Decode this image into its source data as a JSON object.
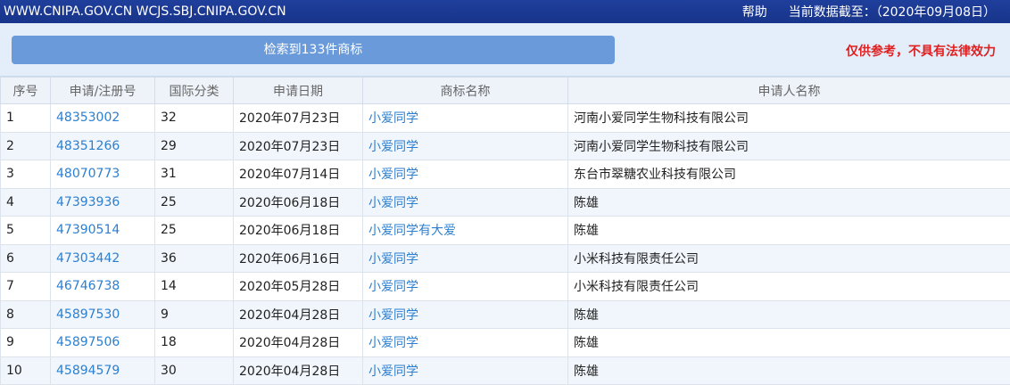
{
  "topbar": {
    "site": "WWW.CNIPA.GOV.CN WCJS.SBJ.CNIPA.GOV.CN",
    "help": "帮助",
    "data_as_of": "当前数据截至：（2020年09月08日）"
  },
  "search": {
    "result_label": "检索到133件商标",
    "disclaimer": "仅供参考，不具有法律效力"
  },
  "table": {
    "headers": [
      "序号",
      "申请/注册号",
      "国际分类",
      "申请日期",
      "商标名称",
      "申请人名称"
    ],
    "rows": [
      {
        "no": "1",
        "reg": "48353002",
        "cls": "32",
        "date": "2020年07月23日",
        "name": "小爱同学",
        "applicant": "河南小爱同学生物科技有限公司"
      },
      {
        "no": "2",
        "reg": "48351266",
        "cls": "29",
        "date": "2020年07月23日",
        "name": "小爱同学",
        "applicant": "河南小爱同学生物科技有限公司"
      },
      {
        "no": "3",
        "reg": "48070773",
        "cls": "31",
        "date": "2020年07月14日",
        "name": "小爱同学",
        "applicant": "东台市翠糖农业科技有限公司"
      },
      {
        "no": "4",
        "reg": "47393936",
        "cls": "25",
        "date": "2020年06月18日",
        "name": "小爱同学",
        "applicant": "陈雄"
      },
      {
        "no": "5",
        "reg": "47390514",
        "cls": "25",
        "date": "2020年06月18日",
        "name": "小爱同学有大爱",
        "applicant": "陈雄"
      },
      {
        "no": "6",
        "reg": "47303442",
        "cls": "36",
        "date": "2020年06月16日",
        "name": "小爱同学",
        "applicant": "小米科技有限责任公司"
      },
      {
        "no": "7",
        "reg": "46746738",
        "cls": "14",
        "date": "2020年05月28日",
        "name": "小爱同学",
        "applicant": "小米科技有限责任公司"
      },
      {
        "no": "8",
        "reg": "45897530",
        "cls": "9",
        "date": "2020年04月28日",
        "name": "小爱同学",
        "applicant": "陈雄"
      },
      {
        "no": "9",
        "reg": "45897506",
        "cls": "18",
        "date": "2020年04月28日",
        "name": "小爱同学",
        "applicant": "陈雄"
      },
      {
        "no": "10",
        "reg": "45894579",
        "cls": "30",
        "date": "2020年04月28日",
        "name": "小爱同学",
        "applicant": "陈雄"
      }
    ]
  }
}
